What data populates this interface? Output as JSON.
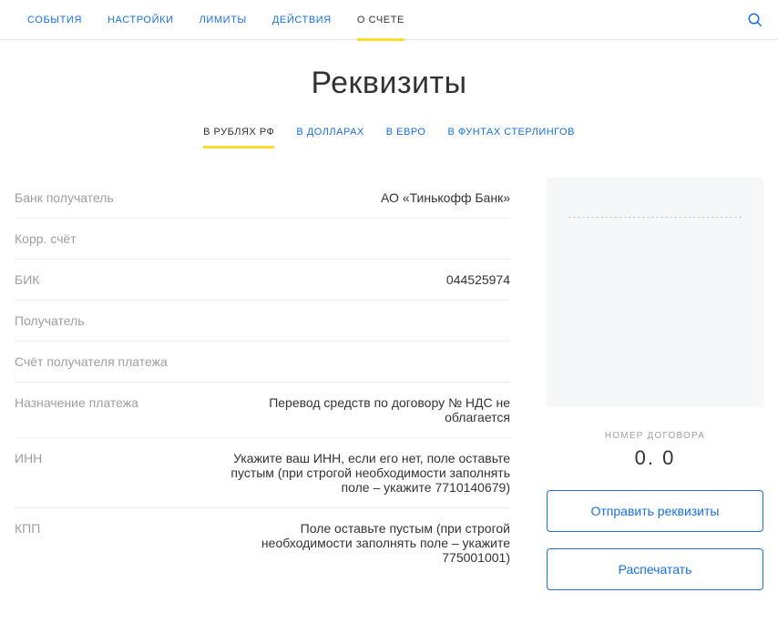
{
  "nav": {
    "items": [
      {
        "label": "СОБЫТИЯ"
      },
      {
        "label": "НАСТРОЙКИ"
      },
      {
        "label": "ЛИМИТЫ"
      },
      {
        "label": "ДЕЙСТВИЯ"
      },
      {
        "label": "О СЧЕТЕ"
      }
    ]
  },
  "page_title": "Реквизиты",
  "currency_tabs": [
    {
      "label": "В РУБЛЯХ РФ"
    },
    {
      "label": "В ДОЛЛАРАХ"
    },
    {
      "label": "В ЕВРО"
    },
    {
      "label": "В ФУНТАХ СТЕРЛИНГОВ"
    }
  ],
  "details": {
    "bank_label": "Банк получатель",
    "bank_value": "АО «Тинькофф Банк»",
    "corr_label": "Корр. счёт",
    "corr_value": "",
    "bik_label": "БИК",
    "bik_value": "044525974",
    "recipient_label": "Получатель",
    "recipient_value": "",
    "account_label": "Счёт получателя платежа",
    "account_value": "",
    "purpose_label": "Назначение платежа",
    "purpose_value": "Перевод средств по договору № НДС не облагается",
    "inn_label": "ИНН",
    "inn_value": "Укажите ваш ИНН, если его нет, поле оставьте пустым (при строгой необходимости заполнять поле – укажите 7710140679)",
    "kpp_label": "КПП",
    "kpp_value": "Поле оставьте пустым (при строгой необходимости заполнять поле – укажите 775001001)"
  },
  "side": {
    "contract_label": "НОМЕР ДОГОВОРА",
    "contract_value": "0.                 0",
    "send_button": "Отправить реквизиты",
    "print_button": "Распечатать"
  }
}
